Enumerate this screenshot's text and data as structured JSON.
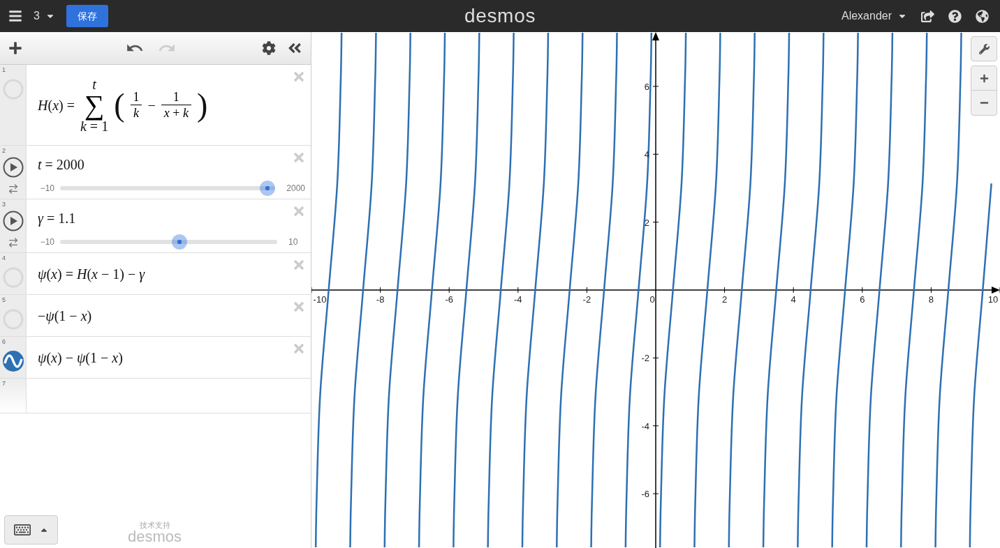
{
  "top_bar": {
    "graph_count": "3",
    "save_button": "保存",
    "logo": "desmos",
    "user": "Alexander"
  },
  "expressions": [
    {
      "number": "1",
      "kind": "sum",
      "shown": false,
      "lhs": "*H*(*x*) =",
      "symbol": "∑",
      "upper": "*t*",
      "lower": "*k* = 1",
      "open": "(",
      "close": ")",
      "op": "−",
      "fractions": [
        {
          "num": "1",
          "den": "*k*"
        },
        {
          "num": "1",
          "den": "*x* + *k*"
        }
      ]
    },
    {
      "number": "2",
      "kind": "slider",
      "text": "*t* = 2000",
      "min": "−10",
      "max": "2000",
      "level": 1.0
    },
    {
      "number": "3",
      "kind": "slider",
      "text": "*γ* = 1.1",
      "min": "−10",
      "max": "10",
      "level": 0.555
    },
    {
      "number": "4",
      "kind": "plain",
      "shown": false,
      "text": "*ψ*(*x*) = *H*(*x* − 1) − *γ*"
    },
    {
      "number": "5",
      "kind": "plain",
      "shown": false,
      "text": "−*ψ*(1 − *x*)"
    },
    {
      "number": "6",
      "kind": "plain",
      "shown": true,
      "text": "*ψ*(*x*) − *ψ*(1 − *x*)"
    },
    {
      "number": "7",
      "kind": "empty"
    }
  ],
  "footer": {
    "powered_by": "技术支持",
    "brand": "desmos"
  },
  "graph": {
    "chart_data": {
      "type": "line",
      "xlim": [
        -10,
        10
      ],
      "ylim": [
        -7.6,
        7.6
      ],
      "xticks": [
        -10,
        -8,
        -6,
        -4,
        -2,
        0,
        2,
        4,
        6,
        8,
        10
      ],
      "yticks": [
        -6,
        -4,
        -2,
        2,
        4,
        6
      ],
      "x": [
        -9.875,
        -9.85,
        -9.75,
        -9.5,
        -9.25,
        -9.15,
        -9.125,
        -8.875,
        -8.85,
        -8.75,
        -8.5,
        -8.25,
        -8.15,
        -8.125,
        -7.875,
        -7.85,
        -7.75,
        -7.5,
        -7.25,
        -7.15,
        -7.125,
        -6.875,
        -6.85,
        -6.75,
        -6.5,
        -6.25,
        -6.15,
        -6.125,
        -5.875,
        -5.85,
        -5.75,
        -5.5,
        -5.25,
        -5.15,
        -5.125,
        -4.875,
        -4.85,
        -4.75,
        -4.5,
        -4.25,
        -4.15,
        -4.125,
        -3.875,
        -3.85,
        -3.75,
        -3.5,
        -3.25,
        -3.15,
        -3.125,
        -2.875,
        -2.85,
        -2.75,
        -2.5,
        -2.25,
        -2.15,
        -2.125,
        -1.875,
        -1.85,
        -1.75,
        -1.5,
        -1.25,
        -1.15,
        -1.125,
        -0.875,
        -0.85,
        -0.75,
        -0.5,
        -0.25,
        -0.15,
        -0.125,
        0.125,
        0.15,
        0.25,
        0.5,
        0.75,
        0.85,
        0.875,
        1.125,
        1.15,
        1.25,
        1.5,
        1.75,
        1.85,
        1.875,
        2.125,
        2.15,
        2.25,
        2.5,
        2.75,
        2.85,
        2.875,
        3.125,
        3.15,
        3.25,
        3.5,
        3.75,
        3.85,
        3.875,
        4.125,
        4.15,
        4.25,
        4.5,
        4.75,
        4.85,
        4.875,
        5.125,
        5.15,
        5.25,
        5.5,
        5.75,
        5.85,
        5.875,
        6.125,
        6.15,
        6.25,
        6.5,
        6.75,
        6.85,
        6.875,
        7.125,
        7.15,
        7.25,
        7.5,
        7.75,
        7.85,
        7.875,
        8.125,
        8.15,
        8.25,
        8.5,
        8.75,
        8.85,
        8.875,
        9.125,
        9.15,
        9.25,
        9.5,
        9.75
      ],
      "series": [
        {
          "color": "#2d70b3",
          "values": [
            -7.58,
            -6.17,
            -3.14,
            0,
            3.14,
            6.17,
            7.58,
            -7.58,
            -6.17,
            -3.14,
            0,
            3.14,
            6.17,
            7.58,
            -7.58,
            -6.17,
            -3.14,
            0,
            3.14,
            6.17,
            7.58,
            -7.58,
            -6.17,
            -3.14,
            0,
            3.14,
            6.17,
            7.58,
            -7.58,
            -6.17,
            -3.14,
            0,
            3.14,
            6.17,
            7.58,
            -7.58,
            -6.17,
            -3.14,
            0,
            3.14,
            6.17,
            7.58,
            -7.58,
            -6.17,
            -3.14,
            0,
            3.14,
            6.17,
            7.58,
            -7.58,
            -6.17,
            -3.14,
            0,
            3.14,
            6.17,
            7.58,
            -7.58,
            -6.17,
            -3.14,
            0,
            3.14,
            6.17,
            7.58,
            -7.58,
            -6.17,
            -3.14,
            0,
            3.14,
            6.17,
            7.58,
            -7.58,
            -6.17,
            -3.14,
            0,
            3.14,
            6.17,
            7.58,
            -7.58,
            -6.17,
            -3.14,
            0,
            3.14,
            6.17,
            7.58,
            -7.58,
            -6.17,
            -3.14,
            0,
            3.14,
            6.17,
            7.58,
            -7.58,
            -6.17,
            -3.14,
            0,
            3.14,
            6.17,
            7.58,
            -7.58,
            -6.17,
            -3.14,
            0,
            3.14,
            6.17,
            7.58,
            -7.58,
            -6.17,
            -3.14,
            0,
            3.14,
            6.17,
            7.58,
            -7.58,
            -6.17,
            -3.14,
            0,
            3.14,
            6.17,
            7.58,
            -7.58,
            -6.17,
            -3.14,
            0,
            3.14,
            6.17,
            7.58,
            -7.58,
            -6.17,
            -3.14,
            0,
            3.14,
            6.17,
            7.58,
            -7.58,
            -6.17,
            -3.14,
            0,
            3.14
          ]
        }
      ]
    }
  }
}
